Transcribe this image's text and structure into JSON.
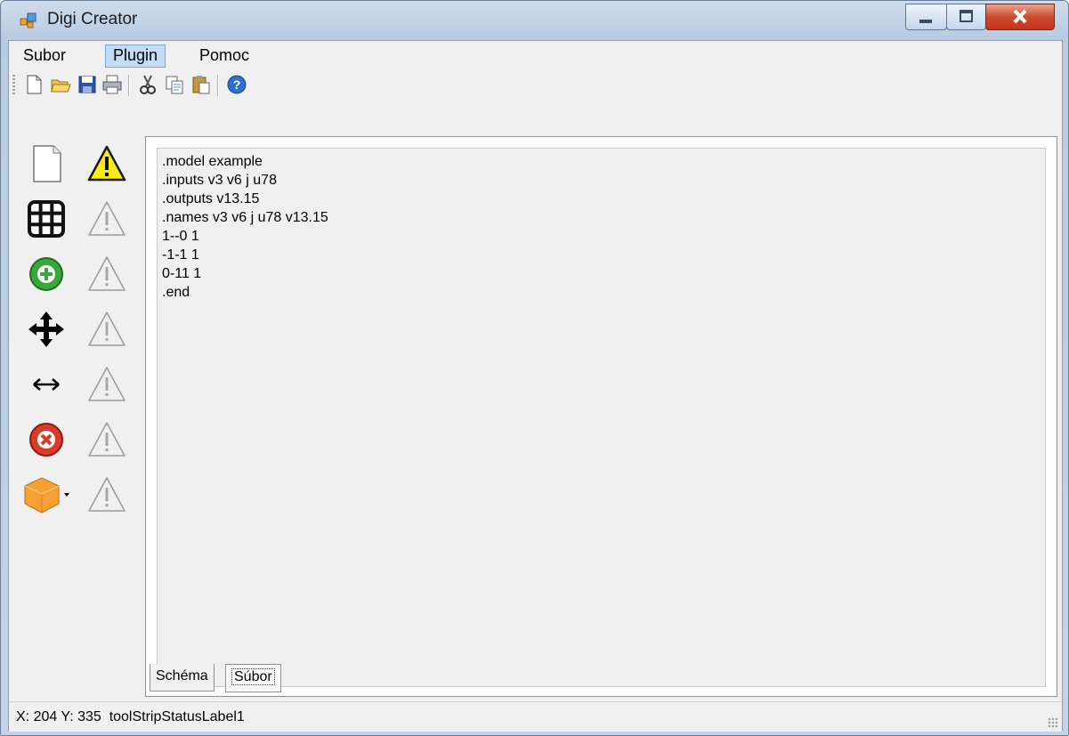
{
  "window": {
    "title": "Digi Creator"
  },
  "menu": {
    "items": [
      "Subor",
      "Plugin",
      "Pomoc"
    ],
    "active": "Plugin"
  },
  "toolbar": {
    "icons": [
      "new-file-icon",
      "open-folder-icon",
      "save-icon",
      "print-icon",
      "cut-icon",
      "copy-icon",
      "paste-icon",
      "help-icon"
    ]
  },
  "tools": [
    {
      "name": "new-document-tool",
      "icon": "document-icon"
    },
    {
      "name": "warning-tool",
      "icon": "warning-icon",
      "enabled": true
    },
    {
      "name": "grid-tool",
      "icon": "grid-icon"
    },
    {
      "name": "add-tool",
      "icon": "plus-circle-icon"
    },
    {
      "name": "move-tool",
      "icon": "move-arrows-icon"
    },
    {
      "name": "resize-tool",
      "icon": "horizontal-arrows-icon"
    },
    {
      "name": "delete-tool",
      "icon": "delete-circle-icon"
    },
    {
      "name": "component-tool",
      "icon": "cube-dropdown-icon"
    }
  ],
  "editor": {
    "lines": [
      ".model example",
      ".inputs v3 v6 j u78",
      ".outputs v13.15",
      ".names v3 v6 j u78 v13.15",
      "1--0 1",
      "-1-1 1",
      "0-11 1",
      ".end"
    ]
  },
  "tabs": [
    {
      "label": "Schéma",
      "selected": false
    },
    {
      "label": "Súbor",
      "selected": true
    }
  ],
  "status": {
    "coords": "X: 204 Y: 335",
    "label": "toolStripStatusLabel1"
  },
  "colors": {
    "menu_active_bg": "#c4dcf4",
    "close_button": "#cc4b2f"
  }
}
